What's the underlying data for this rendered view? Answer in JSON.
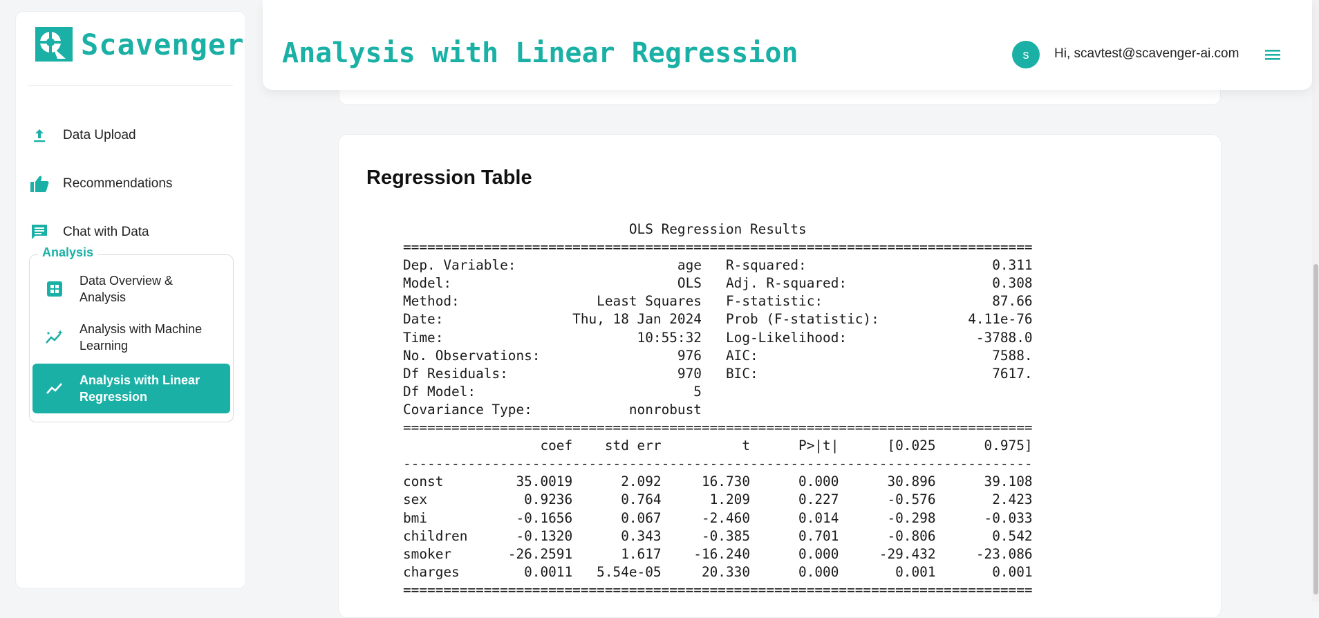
{
  "brand": {
    "name": "Scavenger",
    "accent": "#1ab0a5"
  },
  "nav": {
    "items": [
      {
        "label": "Data Upload",
        "icon": "upload-icon"
      },
      {
        "label": "Recommendations",
        "icon": "thumbs-up-icon"
      },
      {
        "label": "Chat with Data",
        "icon": "chat-icon"
      }
    ],
    "group": {
      "label": "Analysis",
      "items": [
        {
          "label": "Data Overview & Analysis",
          "icon": "grid-icon"
        },
        {
          "label": "Analysis with Machine Learning",
          "icon": "sparkle-chart-icon"
        },
        {
          "label": "Analysis with Linear Regression",
          "icon": "trend-line-icon",
          "active": true
        }
      ]
    }
  },
  "header": {
    "title": "Analysis with Linear Regression",
    "avatar_letter": "s",
    "greeting": "Hi, scavtest@scavenger-ai.com"
  },
  "regression": {
    "title": "Regression Table",
    "text": [
      "                            OLS Regression Results                            ",
      "==============================================================================",
      "Dep. Variable:                    age   R-squared:                       0.311",
      "Model:                            OLS   Adj. R-squared:                  0.308",
      "Method:                 Least Squares   F-statistic:                     87.66",
      "Date:                Thu, 18 Jan 2024   Prob (F-statistic):           4.11e-76",
      "Time:                        10:55:32   Log-Likelihood:                -3788.0",
      "No. Observations:                 976   AIC:                             7588.",
      "Df Residuals:                     970   BIC:                             7617.",
      "Df Model:                           5                                         ",
      "Covariance Type:            nonrobust                                         ",
      "==============================================================================",
      "                 coef    std err          t      P>|t|      [0.025      0.975]",
      "------------------------------------------------------------------------------",
      "const         35.0019      2.092     16.730      0.000      30.896      39.108",
      "sex            0.9236      0.764      1.209      0.227      -0.576       2.423",
      "bmi           -0.1656      0.067     -2.460      0.014      -0.298      -0.033",
      "children      -0.1320      0.343     -0.385      0.701      -0.806       0.542",
      "smoker       -26.2591      1.617    -16.240      0.000     -29.432     -23.086",
      "charges        0.0011   5.54e-05     20.330      0.000       0.001       0.001",
      "=============================================================================="
    ]
  }
}
